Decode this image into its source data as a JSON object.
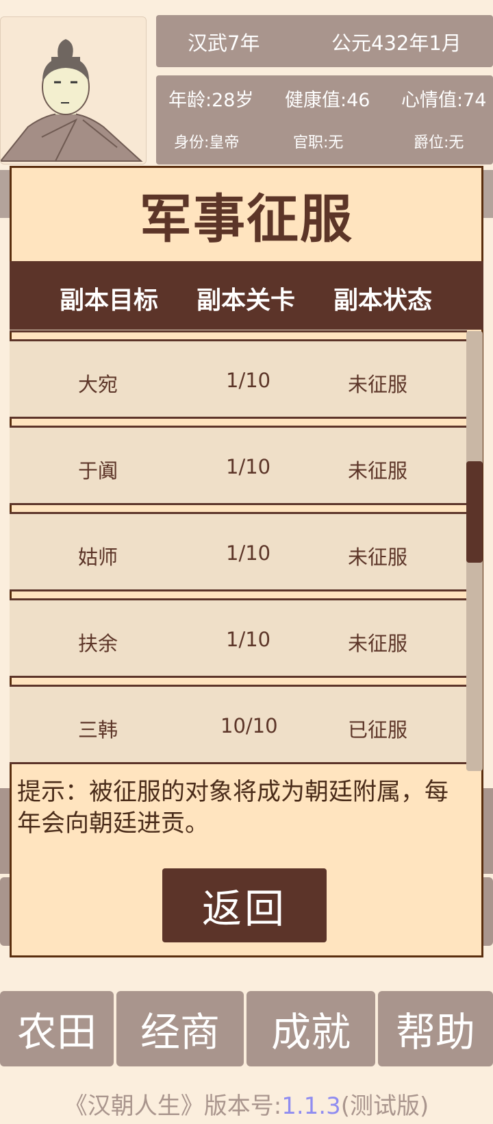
{
  "header": {
    "era": "汉武7年",
    "date": "公元432年1月",
    "age": "年龄:28岁",
    "health": "健康值:46",
    "mood": "心情值:74",
    "identity": "身份:皇帝",
    "office": "官职:无",
    "title": "爵位:无"
  },
  "modal": {
    "title": "军事征服",
    "columns": [
      "副本目标",
      "副本关卡",
      "副本状态"
    ],
    "rows": [
      {
        "target": "大宛",
        "stage": "1/10",
        "status": "未征服"
      },
      {
        "target": "于阗",
        "stage": "1/10",
        "status": "未征服"
      },
      {
        "target": "姑师",
        "stage": "1/10",
        "status": "未征服"
      },
      {
        "target": "扶余",
        "stage": "1/10",
        "status": "未征服"
      },
      {
        "target": "三韩",
        "stage": "10/10",
        "status": "已征服"
      }
    ],
    "tip": "提示：被征服的对象将成为朝廷附属，每年会向朝廷进贡。",
    "back_label": "返回"
  },
  "bottom_menu": {
    "row2": [
      "农田",
      "经商",
      "成就",
      "帮助"
    ]
  },
  "footer": {
    "prefix": "《汉朝人生》版本号:",
    "version": "1.1.3",
    "suffix": "(测试版)"
  },
  "colors": {
    "modal_bg": "#ffe4bf",
    "header_dark": "#5c3429",
    "info_bar": "#a9958d",
    "version_link": "#8f8cf0"
  }
}
